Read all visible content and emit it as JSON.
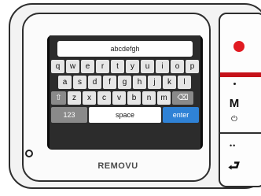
{
  "screen": {
    "text_field_value": "abcdefgh"
  },
  "keyboard": {
    "row1": [
      "q",
      "w",
      "e",
      "r",
      "t",
      "y",
      "u",
      "i",
      "o",
      "p"
    ],
    "row2": [
      "a",
      "s",
      "d",
      "f",
      "g",
      "h",
      "j",
      "k",
      "l"
    ],
    "row3": [
      "z",
      "x",
      "c",
      "v",
      "b",
      "n",
      "m"
    ],
    "shift_glyph": "⇧",
    "backspace_glyph": "⌫",
    "numbers_label": "123",
    "space_label": "space",
    "enter_label": "enter"
  },
  "device": {
    "brand_label": "REMOVU",
    "mode_label": "M",
    "power_glyph": "⏻",
    "back_dots": "••",
    "back_glyph": "⮐"
  },
  "icons": {
    "record": "record-icon",
    "power": "power-icon",
    "back": "back-arrow-icon",
    "shift": "shift-icon",
    "backspace": "backspace-icon"
  },
  "colors": {
    "record_red": "#e11b22",
    "accent_bar_red": "#c5121a",
    "enter_blue": "#2f82d6",
    "device_outline": "#2e2e2e"
  }
}
